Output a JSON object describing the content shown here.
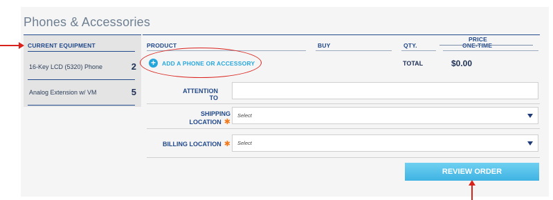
{
  "page": {
    "title": "Phones & Accessories"
  },
  "sidebar": {
    "header": "CURRENT EQUIPMENT",
    "items": [
      {
        "label": "16-Key LCD (5320) Phone",
        "count": "2"
      },
      {
        "label": "Analog Extension w/ VM",
        "count": "5"
      }
    ]
  },
  "table": {
    "columns": {
      "product": "PRODUCT",
      "buy": "BUY",
      "qty": "QTY.",
      "price_top": "PRICE",
      "price_bottom": "ONE-TIME"
    },
    "add_label": "ADD A PHONE OR ACCESSORY",
    "total_label": "TOTAL",
    "total_value": "$0.00"
  },
  "form": {
    "attention_label": "ATTENTION TO",
    "attention_value": "",
    "shipping_label": "SHIPPING LOCATION",
    "shipping_value": "Select",
    "billing_label": "BILLING LOCATION",
    "billing_value": "Select",
    "required_mark": "✱"
  },
  "actions": {
    "review_label": "REVIEW ORDER"
  },
  "icons": {
    "add": "plus-circle-icon",
    "dropdown": "chevron-down-icon"
  },
  "colors": {
    "accent": "#26a7dc",
    "navy": "#21488a",
    "annotation": "#d9221c",
    "required": "#f07a1a"
  }
}
